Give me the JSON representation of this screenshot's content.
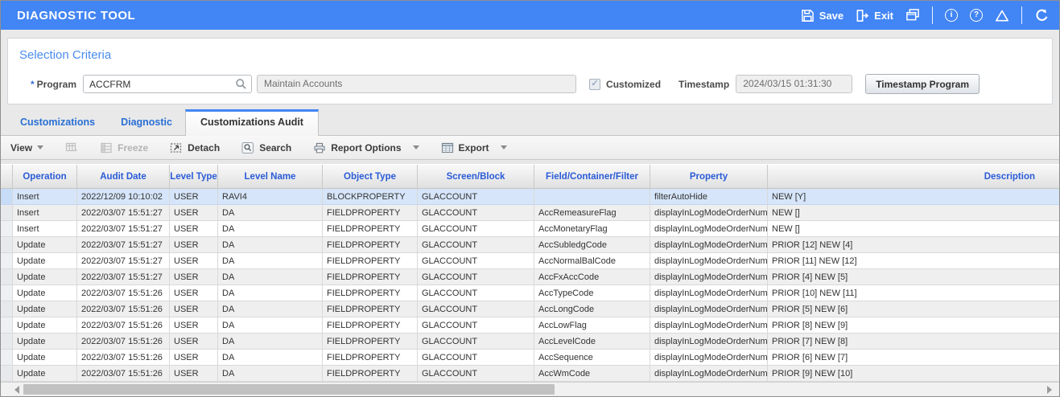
{
  "colors": {
    "accent_blue": "#4285f4",
    "header_text_blue": "#2a5bd7",
    "tab_text_blue": "#2a6fd4",
    "selected_row": "#d6e5f9",
    "band_row": "#efefef"
  },
  "titlebar": {
    "title": "DIAGNOSTIC TOOL",
    "save_label": "Save",
    "exit_label": "Exit"
  },
  "selection_criteria": {
    "title": "Selection Criteria",
    "required_marker": "*",
    "program_label": "Program",
    "program_value": "ACCFRM",
    "program_description": "Maintain Accounts",
    "customized_label": "Customized",
    "customized_checked": "✓",
    "timestamp_label": "Timestamp",
    "timestamp_value": "2024/03/15 01:31:30",
    "timestamp_button_label": "Timestamp Program"
  },
  "tabs": [
    {
      "label": "Customizations",
      "active": false
    },
    {
      "label": "Diagnostic",
      "active": false
    },
    {
      "label": "Customizations Audit",
      "active": true
    }
  ],
  "toolbar": {
    "view_label": "View",
    "freeze_label": "Freeze",
    "detach_label": "Detach",
    "search_label": "Search",
    "report_options_label": "Report Options",
    "export_label": "Export"
  },
  "table": {
    "selected_row_index": 0,
    "columns": [
      "Operation",
      "Audit Date",
      "Level Type",
      "Level Name",
      "Object Type",
      "Screen/Block",
      "Field/Container/Filter",
      "Property",
      "Description"
    ],
    "rows": [
      [
        "Insert",
        "2022/12/09 10:10:02",
        "USER",
        "RAVI4",
        "BLOCKPROPERTY",
        "GLACCOUNT",
        "",
        "filterAutoHide",
        "NEW [Y]"
      ],
      [
        "Insert",
        "2022/03/07 15:51:27",
        "USER",
        "DA",
        "FIELDPROPERTY",
        "GLACCOUNT",
        "AccRemeasureFlag",
        "displayInLogModeOrderNum",
        "NEW []"
      ],
      [
        "Insert",
        "2022/03/07 15:51:27",
        "USER",
        "DA",
        "FIELDPROPERTY",
        "GLACCOUNT",
        "AccMonetaryFlag",
        "displayInLogModeOrderNum",
        "NEW []"
      ],
      [
        "Update",
        "2022/03/07 15:51:27",
        "USER",
        "DA",
        "FIELDPROPERTY",
        "GLACCOUNT",
        "AccSubledgCode",
        "displayInLogModeOrderNum",
        "PRIOR [12] NEW [4]"
      ],
      [
        "Update",
        "2022/03/07 15:51:27",
        "USER",
        "DA",
        "FIELDPROPERTY",
        "GLACCOUNT",
        "AccNormalBalCode",
        "displayInLogModeOrderNum",
        "PRIOR [11] NEW [12]"
      ],
      [
        "Update",
        "2022/03/07 15:51:27",
        "USER",
        "DA",
        "FIELDPROPERTY",
        "GLACCOUNT",
        "AccFxAccCode",
        "displayInLogModeOrderNum",
        "PRIOR [4] NEW [5]"
      ],
      [
        "Update",
        "2022/03/07 15:51:26",
        "USER",
        "DA",
        "FIELDPROPERTY",
        "GLACCOUNT",
        "AccTypeCode",
        "displayInLogModeOrderNum",
        "PRIOR [10] NEW [11]"
      ],
      [
        "Update",
        "2022/03/07 15:51:26",
        "USER",
        "DA",
        "FIELDPROPERTY",
        "GLACCOUNT",
        "AccLongCode",
        "displayInLogModeOrderNum",
        "PRIOR [5] NEW [6]"
      ],
      [
        "Update",
        "2022/03/07 15:51:26",
        "USER",
        "DA",
        "FIELDPROPERTY",
        "GLACCOUNT",
        "AccLowFlag",
        "displayInLogModeOrderNum",
        "PRIOR [8] NEW [9]"
      ],
      [
        "Update",
        "2022/03/07 15:51:26",
        "USER",
        "DA",
        "FIELDPROPERTY",
        "GLACCOUNT",
        "AccLevelCode",
        "displayInLogModeOrderNum",
        "PRIOR [7] NEW [8]"
      ],
      [
        "Update",
        "2022/03/07 15:51:26",
        "USER",
        "DA",
        "FIELDPROPERTY",
        "GLACCOUNT",
        "AccSequence",
        "displayInLogModeOrderNum",
        "PRIOR [6] NEW [7]"
      ],
      [
        "Update",
        "2022/03/07 15:51:26",
        "USER",
        "DA",
        "FIELDPROPERTY",
        "GLACCOUNT",
        "AccWmCode",
        "displayInLogModeOrderNum",
        "PRIOR [9] NEW [10]"
      ]
    ]
  }
}
